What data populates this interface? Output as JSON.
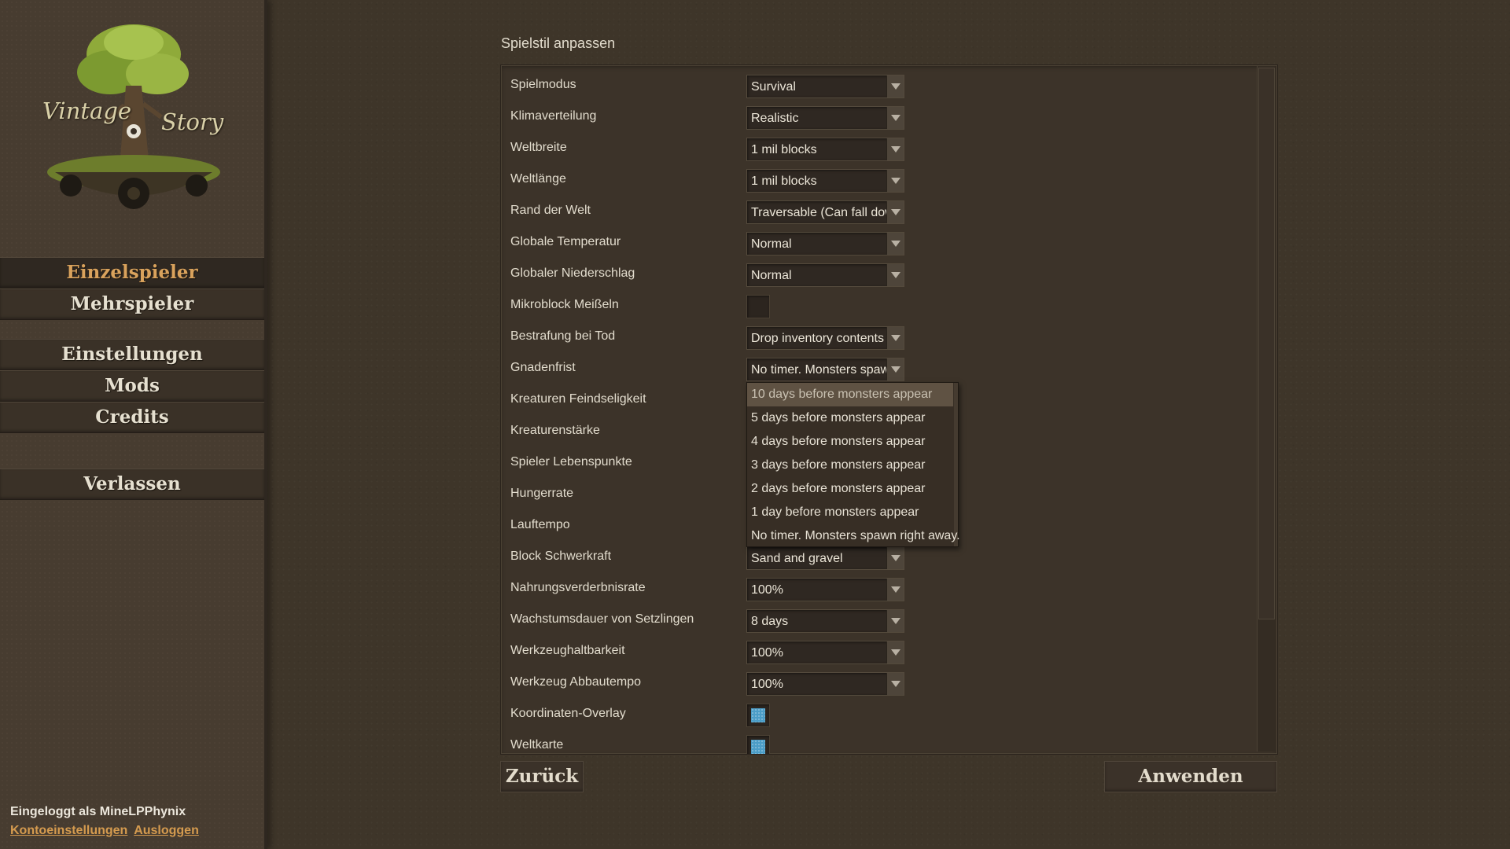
{
  "logo": {
    "word1": "Vintage",
    "word2": "Story"
  },
  "menu": {
    "singleplayer": "Einzelspieler",
    "multiplayer": "Mehrspieler",
    "settings": "Einstellungen",
    "mods": "Mods",
    "credits": "Credits",
    "quit": "Verlassen"
  },
  "account": {
    "logged_in_as": "Eingeloggt als MineLPPhynix",
    "account_settings": "Kontoeinstellungen",
    "logout": "Ausloggen"
  },
  "panel": {
    "title": "Spielstil anpassen",
    "rows": [
      {
        "label": "Spielmodus",
        "type": "dropdown",
        "value": "Survival"
      },
      {
        "label": "Klimaverteilung",
        "type": "dropdown",
        "value": "Realistic"
      },
      {
        "label": "Weltbreite",
        "type": "dropdown",
        "value": "1 mil blocks"
      },
      {
        "label": "Weltlänge",
        "type": "dropdown",
        "value": "1 mil blocks"
      },
      {
        "label": "Rand der Welt",
        "type": "dropdown",
        "value": "Traversable (Can fall dow"
      },
      {
        "label": "Globale Temperatur",
        "type": "dropdown",
        "value": "Normal"
      },
      {
        "label": "Globaler Niederschlag",
        "type": "dropdown",
        "value": "Normal"
      },
      {
        "label": "Mikroblock Meißeln",
        "type": "checkbox",
        "checked": false
      },
      {
        "label": "Bestrafung bei Tod",
        "type": "dropdown",
        "value": "Drop inventory contents"
      },
      {
        "label": "Gnadenfrist",
        "type": "dropdown",
        "value": "No timer. Monsters spawn"
      },
      {
        "label": "Kreaturen Feindseligkeit",
        "type": "hidden"
      },
      {
        "label": "Kreaturenstärke",
        "type": "hidden"
      },
      {
        "label": "Spieler Lebenspunkte",
        "type": "hidden"
      },
      {
        "label": "Hungerrate",
        "type": "hidden"
      },
      {
        "label": "Lauftempo",
        "type": "hidden"
      },
      {
        "label": "Block Schwerkraft",
        "type": "dropdown",
        "value": "Sand and gravel"
      },
      {
        "label": "Nahrungsverderbnisrate",
        "type": "dropdown",
        "value": "100%"
      },
      {
        "label": "Wachstumsdauer von Setzlingen",
        "type": "dropdown",
        "value": "8 days"
      },
      {
        "label": "Werkzeughaltbarkeit",
        "type": "dropdown",
        "value": "100%"
      },
      {
        "label": "Werkzeug Abbautempo",
        "type": "dropdown",
        "value": "100%"
      },
      {
        "label": "Koordinaten-Overlay",
        "type": "checkbox",
        "checked": true
      },
      {
        "label": "Weltkarte",
        "type": "checkbox",
        "checked": true
      }
    ],
    "open_dropdown_options": [
      "10 days before monsters appear",
      "5 days before monsters appear",
      "4 days before monsters appear",
      "3 days before monsters appear",
      "2 days before monsters appear",
      "1 day before monsters appear",
      "No timer. Monsters spawn right away."
    ],
    "hovered_option": "10 days before monsters appear"
  },
  "buttons": {
    "back": "Zurück",
    "apply": "Anwenden"
  },
  "colors": {
    "accent": "#d9a25c",
    "link": "#d59b4f",
    "checkbox_fill": "#4b9dc7"
  }
}
